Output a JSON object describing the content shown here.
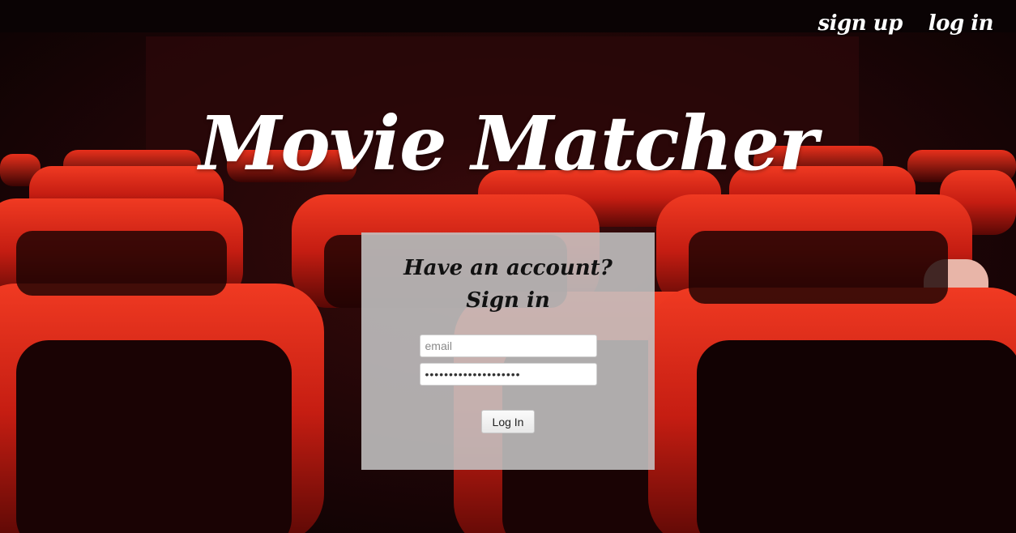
{
  "nav": {
    "signup_label": "sign up",
    "login_label": "log in"
  },
  "hero": {
    "title": "Movie Matcher"
  },
  "login_panel": {
    "heading_line1": "Have an account?",
    "heading_line2": "Sign in",
    "email_placeholder": "email",
    "password_value": "••••••••••••••••••••",
    "submit_label": "Log In"
  },
  "colors": {
    "panel_bg": "#c4c4c4",
    "title_text": "#ffffff",
    "seat_red": "#d42518",
    "background_dark": "#0d0304"
  }
}
